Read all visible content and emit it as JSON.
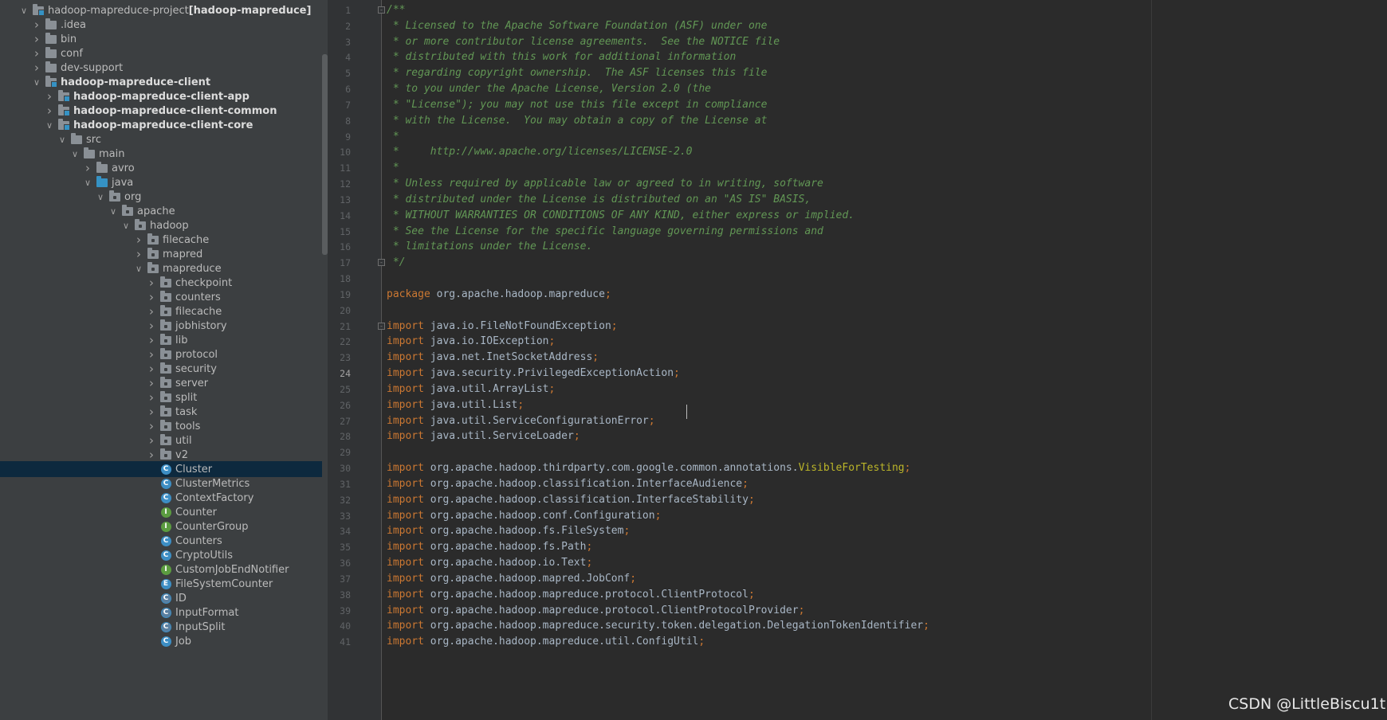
{
  "project_tree": [
    {
      "label": "hadoop-mapreduce-project",
      "suffix": " [hadoop-mapreduce]",
      "depth": 0,
      "expanded": true,
      "icon": "module",
      "bold_suffix": true
    },
    {
      "label": ".idea",
      "depth": 1,
      "expanded": false,
      "icon": "folder"
    },
    {
      "label": "bin",
      "depth": 1,
      "expanded": false,
      "icon": "folder"
    },
    {
      "label": "conf",
      "depth": 1,
      "expanded": false,
      "icon": "folder"
    },
    {
      "label": "dev-support",
      "depth": 1,
      "expanded": false,
      "icon": "folder"
    },
    {
      "label": "hadoop-mapreduce-client",
      "depth": 1,
      "expanded": true,
      "icon": "module",
      "bold": true
    },
    {
      "label": "hadoop-mapreduce-client-app",
      "depth": 2,
      "expanded": false,
      "icon": "module",
      "bold": true
    },
    {
      "label": "hadoop-mapreduce-client-common",
      "depth": 2,
      "expanded": false,
      "icon": "module",
      "bold": true
    },
    {
      "label": "hadoop-mapreduce-client-core",
      "depth": 2,
      "expanded": true,
      "icon": "module",
      "bold": true
    },
    {
      "label": "src",
      "depth": 3,
      "expanded": true,
      "icon": "folder"
    },
    {
      "label": "main",
      "depth": 4,
      "expanded": true,
      "icon": "folder"
    },
    {
      "label": "avro",
      "depth": 5,
      "expanded": false,
      "icon": "folder"
    },
    {
      "label": "java",
      "depth": 5,
      "expanded": true,
      "icon": "src"
    },
    {
      "label": "org",
      "depth": 6,
      "expanded": true,
      "icon": "package"
    },
    {
      "label": "apache",
      "depth": 7,
      "expanded": true,
      "icon": "package"
    },
    {
      "label": "hadoop",
      "depth": 8,
      "expanded": true,
      "icon": "package"
    },
    {
      "label": "filecache",
      "depth": 9,
      "expanded": false,
      "icon": "package"
    },
    {
      "label": "mapred",
      "depth": 9,
      "expanded": false,
      "icon": "package"
    },
    {
      "label": "mapreduce",
      "depth": 9,
      "expanded": true,
      "icon": "package"
    },
    {
      "label": "checkpoint",
      "depth": 10,
      "expanded": false,
      "icon": "package"
    },
    {
      "label": "counters",
      "depth": 10,
      "expanded": false,
      "icon": "package"
    },
    {
      "label": "filecache",
      "depth": 10,
      "expanded": false,
      "icon": "package"
    },
    {
      "label": "jobhistory",
      "depth": 10,
      "expanded": false,
      "icon": "package"
    },
    {
      "label": "lib",
      "depth": 10,
      "expanded": false,
      "icon": "package"
    },
    {
      "label": "protocol",
      "depth": 10,
      "expanded": false,
      "icon": "package"
    },
    {
      "label": "security",
      "depth": 10,
      "expanded": false,
      "icon": "package"
    },
    {
      "label": "server",
      "depth": 10,
      "expanded": false,
      "icon": "package"
    },
    {
      "label": "split",
      "depth": 10,
      "expanded": false,
      "icon": "package"
    },
    {
      "label": "task",
      "depth": 10,
      "expanded": false,
      "icon": "package"
    },
    {
      "label": "tools",
      "depth": 10,
      "expanded": false,
      "icon": "package"
    },
    {
      "label": "util",
      "depth": 10,
      "expanded": false,
      "icon": "package"
    },
    {
      "label": "v2",
      "depth": 10,
      "expanded": false,
      "icon": "package"
    },
    {
      "label": "Cluster",
      "depth": 10,
      "leaf": true,
      "icon": "class",
      "kind": "C",
      "selected": true
    },
    {
      "label": "ClusterMetrics",
      "depth": 10,
      "leaf": true,
      "icon": "class",
      "kind": "C"
    },
    {
      "label": "ContextFactory",
      "depth": 10,
      "leaf": true,
      "icon": "class",
      "kind": "C"
    },
    {
      "label": "Counter",
      "depth": 10,
      "leaf": true,
      "icon": "interface",
      "kind": "I"
    },
    {
      "label": "CounterGroup",
      "depth": 10,
      "leaf": true,
      "icon": "interface",
      "kind": "I"
    },
    {
      "label": "Counters",
      "depth": 10,
      "leaf": true,
      "icon": "class",
      "kind": "C"
    },
    {
      "label": "CryptoUtils",
      "depth": 10,
      "leaf": true,
      "icon": "class",
      "kind": "C"
    },
    {
      "label": "CustomJobEndNotifier",
      "depth": 10,
      "leaf": true,
      "icon": "interface",
      "kind": "I"
    },
    {
      "label": "FileSystemCounter",
      "depth": 10,
      "leaf": true,
      "icon": "enum",
      "kind": "E"
    },
    {
      "label": "ID",
      "depth": 10,
      "leaf": true,
      "icon": "abstract",
      "kind": "C"
    },
    {
      "label": "InputFormat",
      "depth": 10,
      "leaf": true,
      "icon": "abstract",
      "kind": "C"
    },
    {
      "label": "InputSplit",
      "depth": 10,
      "leaf": true,
      "icon": "abstract",
      "kind": "C"
    },
    {
      "label": "Job",
      "depth": 10,
      "leaf": true,
      "icon": "class",
      "kind": "C"
    }
  ],
  "editor": {
    "current_line": 24,
    "lines": [
      {
        "n": 1,
        "type": "comment",
        "text": "/**",
        "fold": "open"
      },
      {
        "n": 2,
        "type": "comment",
        "text": " * Licensed to the Apache Software Foundation (ASF) under one"
      },
      {
        "n": 3,
        "type": "comment",
        "text": " * or more contributor license agreements.  See the NOTICE file"
      },
      {
        "n": 4,
        "type": "comment",
        "text": " * distributed with this work for additional information"
      },
      {
        "n": 5,
        "type": "comment",
        "text": " * regarding copyright ownership.  The ASF licenses this file"
      },
      {
        "n": 6,
        "type": "comment",
        "text": " * to you under the Apache License, Version 2.0 (the"
      },
      {
        "n": 7,
        "type": "comment",
        "text": " * \"License\"); you may not use this file except in compliance"
      },
      {
        "n": 8,
        "type": "comment",
        "text": " * with the License.  You may obtain a copy of the License at"
      },
      {
        "n": 9,
        "type": "comment",
        "text": " *"
      },
      {
        "n": 10,
        "type": "comment",
        "text": " *     http://www.apache.org/licenses/LICENSE-2.0"
      },
      {
        "n": 11,
        "type": "comment",
        "text": " *"
      },
      {
        "n": 12,
        "type": "comment",
        "text": " * Unless required by applicable law or agreed to in writing, software"
      },
      {
        "n": 13,
        "type": "comment",
        "text": " * distributed under the License is distributed on an \"AS IS\" BASIS,"
      },
      {
        "n": 14,
        "type": "comment",
        "text": " * WITHOUT WARRANTIES OR CONDITIONS OF ANY KIND, either express or implied."
      },
      {
        "n": 15,
        "type": "comment",
        "text": " * See the License for the specific language governing permissions and"
      },
      {
        "n": 16,
        "type": "comment",
        "text": " * limitations under the License."
      },
      {
        "n": 17,
        "type": "comment",
        "text": " */",
        "fold": "close"
      },
      {
        "n": 18,
        "type": "blank",
        "text": ""
      },
      {
        "n": 19,
        "type": "code",
        "kw": "package",
        "text": "org.apache.hadoop.mapreduce"
      },
      {
        "n": 20,
        "type": "blank",
        "text": ""
      },
      {
        "n": 21,
        "type": "code",
        "kw": "import",
        "text": "java.io.FileNotFoundException",
        "fold": "open"
      },
      {
        "n": 22,
        "type": "code",
        "kw": "import",
        "text": "java.io.IOException"
      },
      {
        "n": 23,
        "type": "code",
        "kw": "import",
        "text": "java.net.InetSocketAddress"
      },
      {
        "n": 24,
        "type": "code",
        "kw": "import",
        "text": "java.security.PrivilegedExceptionAction"
      },
      {
        "n": 25,
        "type": "code",
        "kw": "import",
        "text": "java.util.ArrayList"
      },
      {
        "n": 26,
        "type": "code",
        "kw": "import",
        "text": "java.util.List"
      },
      {
        "n": 27,
        "type": "code",
        "kw": "import",
        "text": "java.util.ServiceConfigurationError"
      },
      {
        "n": 28,
        "type": "code",
        "kw": "import",
        "text": "java.util.ServiceLoader"
      },
      {
        "n": 29,
        "type": "blank",
        "text": ""
      },
      {
        "n": 30,
        "type": "code",
        "kw": "import",
        "text": "org.apache.hadoop.thirdparty.com.google.common.annotations.",
        "ann": "VisibleForTesting"
      },
      {
        "n": 31,
        "type": "code",
        "kw": "import",
        "text": "org.apache.hadoop.classification.InterfaceAudience"
      },
      {
        "n": 32,
        "type": "code",
        "kw": "import",
        "text": "org.apache.hadoop.classification.InterfaceStability"
      },
      {
        "n": 33,
        "type": "code",
        "kw": "import",
        "text": "org.apache.hadoop.conf.Configuration"
      },
      {
        "n": 34,
        "type": "code",
        "kw": "import",
        "text": "org.apache.hadoop.fs.FileSystem"
      },
      {
        "n": 35,
        "type": "code",
        "kw": "import",
        "text": "org.apache.hadoop.fs.Path"
      },
      {
        "n": 36,
        "type": "code",
        "kw": "import",
        "text": "org.apache.hadoop.io.Text"
      },
      {
        "n": 37,
        "type": "code",
        "kw": "import",
        "text": "org.apache.hadoop.mapred.JobConf"
      },
      {
        "n": 38,
        "type": "code",
        "kw": "import",
        "text": "org.apache.hadoop.mapreduce.protocol.ClientProtocol"
      },
      {
        "n": 39,
        "type": "code",
        "kw": "import",
        "text": "org.apache.hadoop.mapreduce.protocol.ClientProtocolProvider"
      },
      {
        "n": 40,
        "type": "code",
        "kw": "import",
        "text": "org.apache.hadoop.mapreduce.security.token.delegation.DelegationTokenIdentifier"
      },
      {
        "n": 41,
        "type": "code",
        "kw": "import",
        "text": "org.apache.hadoop.mapreduce.util.ConfigUtil"
      }
    ]
  },
  "watermark": "CSDN @LittleBiscu1t",
  "colors": {
    "tree_bg": "#3c3f41",
    "editor_bg": "#2b2b2b",
    "comment": "#629755",
    "keyword": "#cc7832",
    "annotation": "#bbb529",
    "code_text": "#a9b7c6",
    "selection": "#0d293e"
  }
}
